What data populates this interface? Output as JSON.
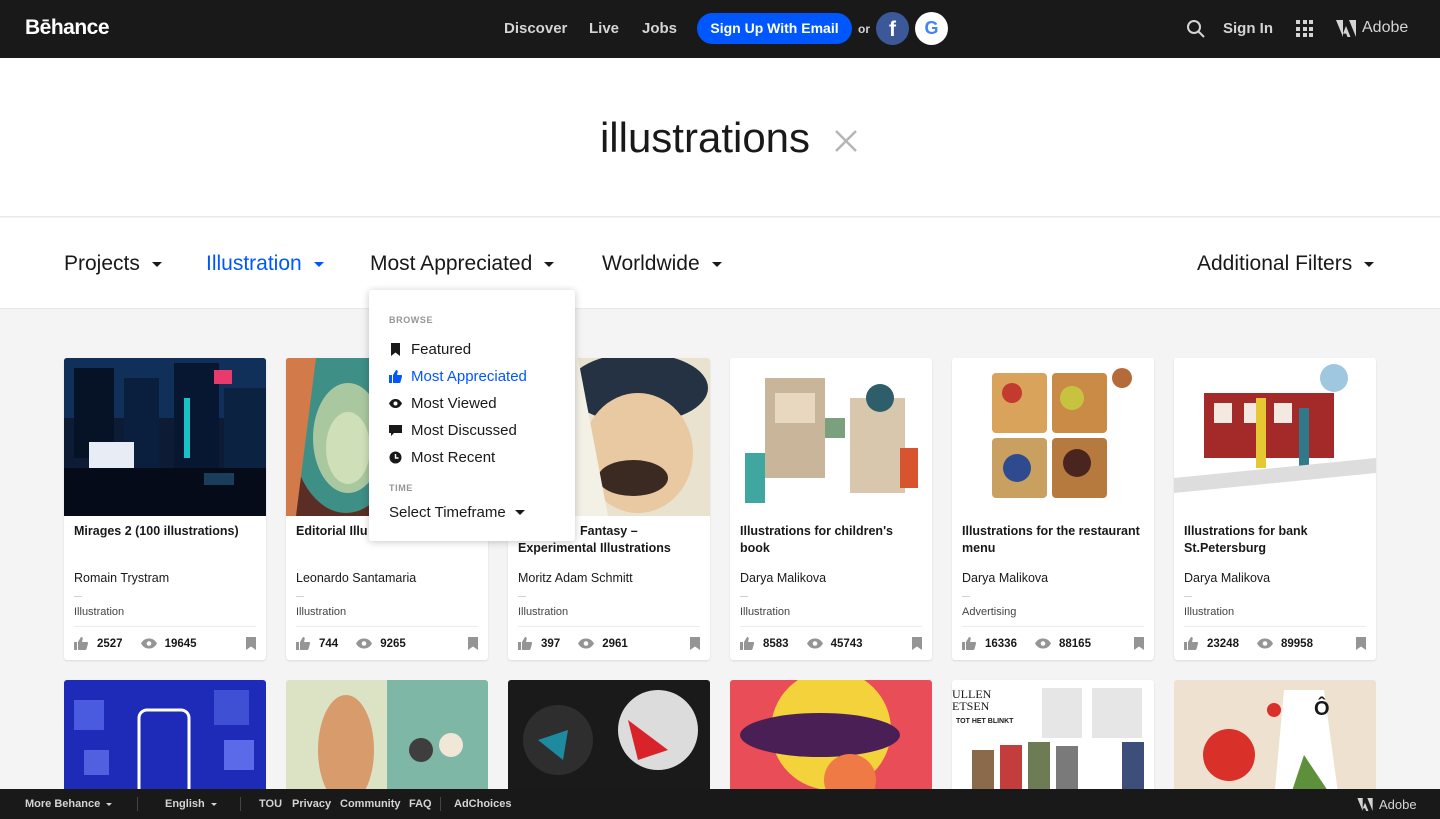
{
  "header": {
    "logo": "Bēhance",
    "nav": [
      "Discover",
      "Live",
      "Jobs"
    ],
    "signup_label": "Sign Up With Email",
    "or_label": "or",
    "facebook_glyph": "f",
    "google_glyph": "G",
    "signin_label": "Sign In",
    "adobe_label": "Adobe"
  },
  "search": {
    "query": "illustrations"
  },
  "filters": {
    "projects": "Projects",
    "illustration": "Illustration",
    "sort": "Most Appreciated",
    "location": "Worldwide",
    "additional": "Additional Filters",
    "active_color": "#0057ff"
  },
  "dropdown": {
    "browse_heading": "BROWSE",
    "items": [
      "Featured",
      "Most Appreciated",
      "Most Viewed",
      "Most Discussed",
      "Most Recent"
    ],
    "selected": "Most Appreciated",
    "time_heading": "TIME",
    "timeframe_label": "Select Timeframe"
  },
  "projects": [
    {
      "title": "Mirages 2 (100 illustrations)",
      "owner": "Romain Trystram",
      "field": "Illustration",
      "appreciations": "2527",
      "views": "19645"
    },
    {
      "title": "Editorial Illu",
      "owner": "Leonardo Santamaria",
      "field": "Illustration",
      "appreciations": "744",
      "views": "9265"
    },
    {
      "title": "Fantasy – Experimental Illustrations",
      "owner": "Moritz Adam Schmitt",
      "field": "Illustration",
      "appreciations": "397",
      "views": "2961"
    },
    {
      "title": "Illustrations for children's book",
      "owner": "Darya Malikova",
      "field": "Illustration",
      "appreciations": "8583",
      "views": "45743"
    },
    {
      "title": "Illustrations for the restaurant menu",
      "owner": "Darya Malikova",
      "field": "Advertising",
      "appreciations": "16336",
      "views": "88165"
    },
    {
      "title": "Illustrations for bank St.Petersburg",
      "owner": "Darya Malikova",
      "field": "Illustration",
      "appreciations": "23248",
      "views": "89958"
    }
  ],
  "thumb_row2_text": {
    "magazine_heading": "ULLEN ETSEN",
    "magazine_sub": "TOT HET BLINKT",
    "product_mark": "Ô"
  },
  "footer": {
    "more": "More Behance",
    "language": "English",
    "links": [
      "TOU",
      "Privacy",
      "Community",
      "FAQ"
    ],
    "adchoices": "AdChoices",
    "adobe": "Adobe"
  }
}
